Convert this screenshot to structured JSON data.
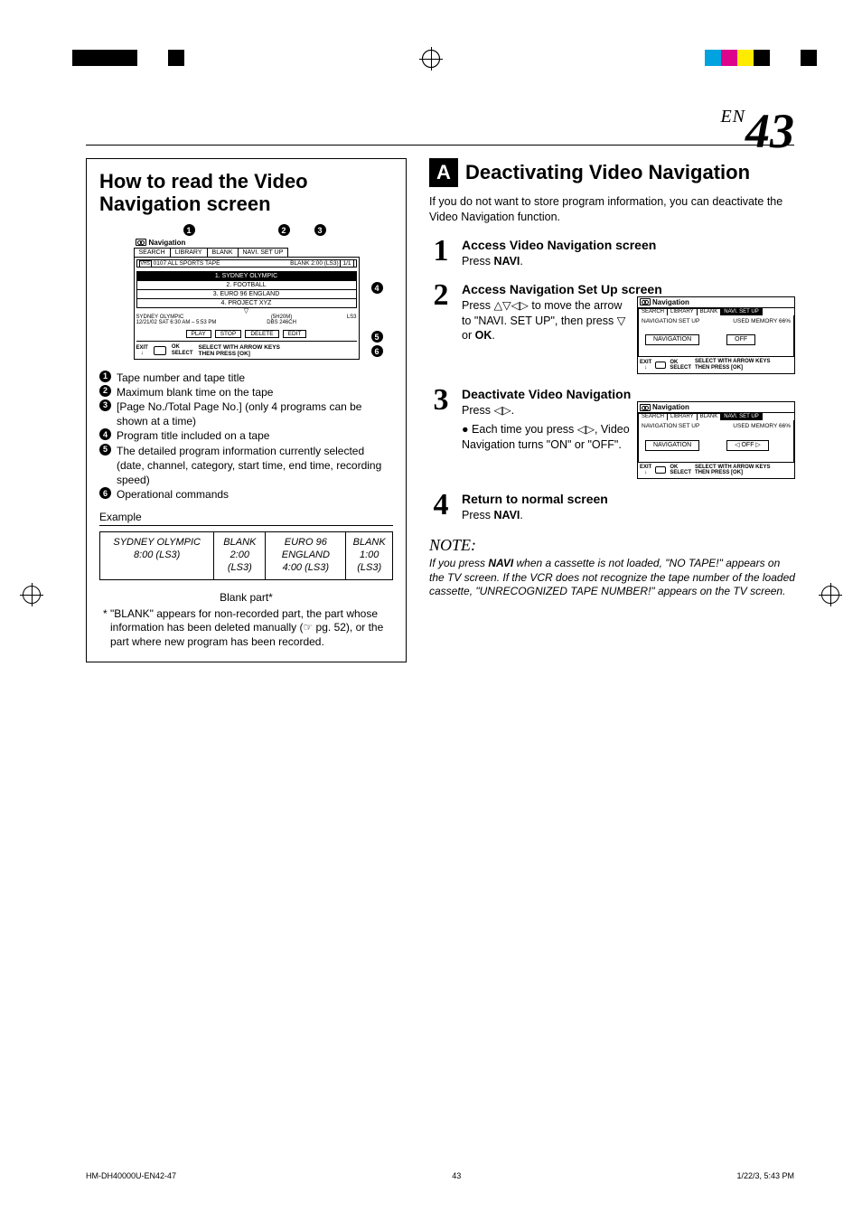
{
  "page": {
    "lang_prefix": "EN",
    "number": "43"
  },
  "left": {
    "box_title": "How to read the Video Navigation screen",
    "nav_screen": {
      "logo": "Navigation",
      "tabs": [
        "SEARCH",
        "LIBRARY",
        "BLANK",
        "NAVI. SET UP"
      ],
      "tape_id": "0107",
      "tape_title": "ALL SPORTS TAPE",
      "blank_label": "BLANK 2:00 (LS3)",
      "pager": "1/1",
      "programs": [
        "1. SYDNEY OLYMPIC",
        "2. FOOTBALL",
        "3. EURO 96 ENGLAND",
        "4. PROJECT XYZ"
      ],
      "detail_line1": "SYDNEY OLYMPIC",
      "detail_line2_left": "12/21/02 SAT  6:30 AM – 5:53 PM",
      "detail_line2_mid": "(5H20M)\nDBS 246CH",
      "detail_line2_right": "LS3",
      "commands": [
        "PLAY",
        "STOP",
        "DELETE",
        "EDIT"
      ],
      "footer_exit": "EXIT",
      "footer_ok": "OK",
      "footer_select": "SELECT",
      "footer_help": "SELECT WITH ARROW KEYS\nTHEN PRESS [OK]"
    },
    "legend": {
      "1": "Tape number and tape title",
      "2": "Maximum blank time on the tape",
      "3": "[Page No./Total Page No.] (only 4 programs can be shown at a time)",
      "4": "Program title included on a tape",
      "5": "The detailed program information currently selected (date, channel, category, start time, end time, recording speed)",
      "6": "Operational commands"
    },
    "example_label": "Example",
    "example": [
      {
        "l1": "SYDNEY OLYMPIC",
        "l2": "8:00 (LS3)"
      },
      {
        "l1": "BLANK",
        "l2": "2:00",
        "l3": "(LS3)"
      },
      {
        "l1": "EURO 96",
        "l2": "ENGLAND",
        "l3": "4:00 (LS3)"
      },
      {
        "l1": "BLANK",
        "l2": "1:00",
        "l3": "(LS3)"
      }
    ],
    "blank_part_label": "Blank part*",
    "footnote": "* \"BLANK\" appears for non-recorded part, the part whose information has been deleted manually (☞ pg. 52), or the part where new program has been recorded."
  },
  "right": {
    "section_letter": "A",
    "section_title": "Deactivating Video Navigation",
    "intro": "If you do not want to store program information, you can deactivate the Video Navigation function.",
    "steps": {
      "1": {
        "title": "Access Video Navigation screen",
        "text": "Press NAVI."
      },
      "2": {
        "title": "Access Navigation Set Up screen",
        "text": "Press △▽◁▷ to move the arrow to \"NAVI. SET UP\", then press ▽ or OK.",
        "osd": {
          "logo": "Navigation",
          "tabs": [
            "SEARCH",
            "LIBRARY",
            "BLANK",
            "NAVI. SET UP"
          ],
          "sel": 3,
          "row_label": "NAVIGATION SET UP",
          "row_right": "USED MEMORY  66%",
          "field_label": "NAVIGATION",
          "field_value": "OFF",
          "help": "SELECT WITH ARROW KEYS\nTHEN PRESS [OK]"
        }
      },
      "3": {
        "title": "Deactivate Video Navigation",
        "text1": "Press ◁▷.",
        "bullet": "Each time you press ◁▷, Video Navigation turns \"ON\" or \"OFF\".",
        "osd": {
          "logo": "Navigation",
          "tabs": [
            "SEARCH",
            "LIBRARY",
            "BLANK",
            "NAVI. SET UP"
          ],
          "sel": 3,
          "row_label": "NAVIGATION SET UP",
          "row_right": "USED MEMORY  66%",
          "field_label": "NAVIGATION",
          "field_value": "◁      OFF      ▷",
          "help": "SELECT WITH ARROW KEYS\nTHEN PRESS [OK]"
        }
      },
      "4": {
        "title": "Return to normal screen",
        "text": "Press NAVI."
      }
    },
    "note_head": "NOTE:",
    "note_body": "If you press NAVI when a cassette is not loaded, \"NO TAPE!\" appears on the TV screen. If the VCR does not recognize the tape number of the loaded cassette, \"UNRECOGNIZED TAPE NUMBER!\" appears on the TV screen."
  },
  "footer": {
    "file": "HM-DH40000U-EN42-47",
    "page": "43",
    "datetime": "1/22/3, 5:43 PM"
  }
}
